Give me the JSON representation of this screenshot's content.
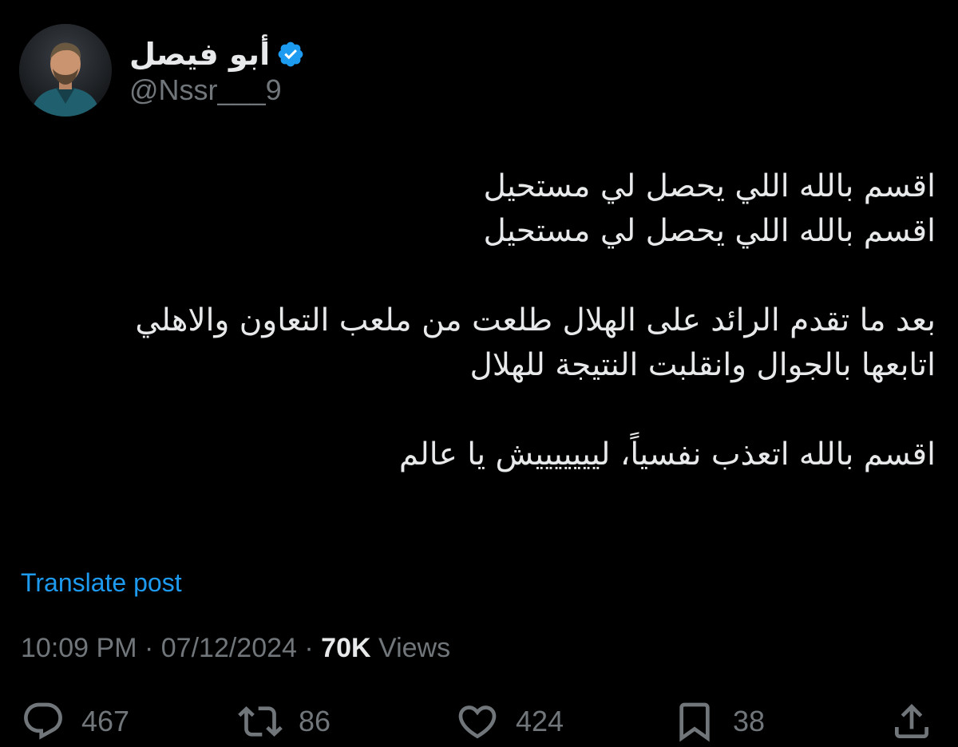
{
  "author": {
    "display_name": "أبو فيصل",
    "handle": "@Nssr___9",
    "verified": true,
    "avatar_icon": "avatar-photo"
  },
  "post": {
    "lines": [
      "اقسم بالله اللي يحصل لي مستحيل",
      "اقسم بالله اللي يحصل لي مستحيل",
      "",
      "بعد ما تقدم الرائد على الهلال طلعت من ملعب التعاون والاهلي",
      "اتابعها بالجوال وانقلبت النتيجة للهلال",
      "",
      "اقسم بالله اتعذب نفسياً، ليييييييش يا عالم"
    ]
  },
  "translate_label": "Translate post",
  "meta": {
    "time": "10:09 PM",
    "separator": "·",
    "date": "07/12/2024",
    "views_count": "70K",
    "views_label": "Views"
  },
  "actions": {
    "replies": {
      "icon": "reply-icon",
      "count": "467"
    },
    "reposts": {
      "icon": "repost-icon",
      "count": "86"
    },
    "likes": {
      "icon": "heart-icon",
      "count": "424"
    },
    "bookmarks": {
      "icon": "bookmark-icon",
      "count": "38"
    },
    "share": {
      "icon": "share-icon"
    }
  },
  "colors": {
    "background": "#000000",
    "text": "#e7e9ea",
    "secondary": "#71767b",
    "accent": "#1d9bf0"
  }
}
